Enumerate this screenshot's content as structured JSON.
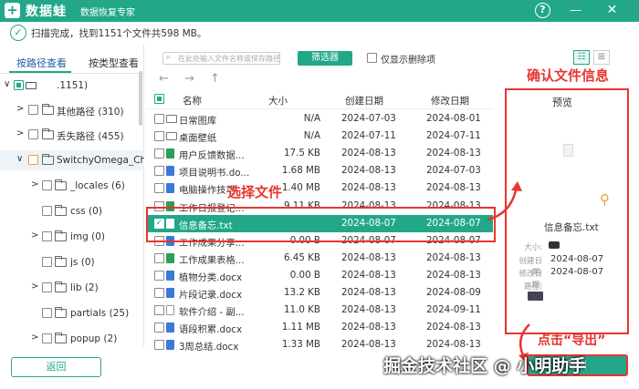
{
  "app": {
    "name": "数据蛙",
    "subtitle": "数据恢复专家"
  },
  "window": {
    "help": "?",
    "minimize": "—",
    "close": "✕"
  },
  "status": {
    "text": "扫描完成，找到1151个文件共598 MB。"
  },
  "tabs": {
    "by_path": "按路径查看",
    "by_type": "按类型查看"
  },
  "tree": {
    "root": {
      "label": ".1151)"
    },
    "items": [
      {
        "label": "其他路径 (310)"
      },
      {
        "label": "丢失路径 (455)"
      },
      {
        "label": "SwitchyOmega_Chrom"
      },
      {
        "label": "_locales (6)"
      },
      {
        "label": "css (0)"
      },
      {
        "label": "img (0)"
      },
      {
        "label": "js (0)"
      },
      {
        "label": "lib (2)"
      },
      {
        "label": "partials (25)"
      },
      {
        "label": "popup (2)"
      }
    ]
  },
  "toolbar": {
    "search_placeholder": "在此处输入文件名称或保存路径",
    "filter_label": "筛选器",
    "deleted_only_label": "仅显示删除项"
  },
  "nav": {
    "back": "←",
    "forward": "→",
    "up": "↑"
  },
  "columns": {
    "name": "名称",
    "size": "大小",
    "created": "创建日期",
    "modified": "修改日期"
  },
  "files": [
    {
      "name": "日常图库",
      "size": "N/A",
      "created": "2024-07-03",
      "modified": "2024-08-01",
      "icon": "folder-icon"
    },
    {
      "name": "桌面壁纸",
      "size": "N/A",
      "created": "2024-07-11",
      "modified": "2024-07-11",
      "icon": "folder-icon"
    },
    {
      "name": "用户反馈数据...",
      "size": "17.5 KB",
      "created": "2024-08-13",
      "modified": "2024-08-13",
      "icon": "excel-icon"
    },
    {
      "name": "项目说明书.do...",
      "size": "1.68 MB",
      "created": "2024-08-13",
      "modified": "2024-07-03",
      "icon": "word-icon"
    },
    {
      "name": "电脑操作技巧...",
      "size": "1.40 MB",
      "created": "2024-08-13",
      "modified": "2024-08-13",
      "icon": "word-icon"
    },
    {
      "name": "工作日报登记...",
      "size": "9.11 KB",
      "created": "2024-08-13",
      "modified": "2024-08-13",
      "icon": "excel-icon"
    },
    {
      "name": "信息备忘.txt",
      "size": "",
      "created": "2024-08-07",
      "modified": "2024-08-07",
      "icon": "text-file-icon"
    },
    {
      "name": "工作成果分享...",
      "size": "0.00  B",
      "created": "2024-08-07",
      "modified": "2024-08-07",
      "icon": "word-icon"
    },
    {
      "name": "工作成果表格...",
      "size": "6.45 KB",
      "created": "2024-08-13",
      "modified": "2024-08-13",
      "icon": "excel-icon"
    },
    {
      "name": "植物分类.docx",
      "size": "0.00  B",
      "created": "2024-08-13",
      "modified": "2024-08-13",
      "icon": "word-icon"
    },
    {
      "name": "片段记录.docx",
      "size": "13.2 KB",
      "created": "2024-08-13",
      "modified": "2024-08-09",
      "icon": "word-icon"
    },
    {
      "name": "软件介绍 - 副...",
      "size": "11.0 KB",
      "created": "2024-08-13",
      "modified": "2024-09-11",
      "icon": "text-file-icon"
    },
    {
      "name": "语段积累.docx",
      "size": "1.11 MB",
      "created": "2024-08-13",
      "modified": "2024-08-13",
      "icon": "word-icon"
    },
    {
      "name": "3周总结.docx",
      "size": "1.33 MB",
      "created": "2024-08-13",
      "modified": "2024-08-13",
      "icon": "word-icon"
    }
  ],
  "preview": {
    "title": "预览",
    "filename": "信息备忘.txt",
    "size_key": "大小:",
    "created_key": "创建日期:",
    "modified_key": "修改日期:",
    "path_key": "路径:",
    "created": "2024-08-07",
    "modified": "2024-08-07"
  },
  "buttons": {
    "back": "返回",
    "export": "导出"
  },
  "annotations": {
    "confirm": "确认文件信息",
    "select": "选择文件",
    "export": "点击“导出”"
  },
  "watermark": "掘金技术社区 @ 小明助手",
  "colors": {
    "accent": "#22a889",
    "annotation": "#e8352f",
    "partial_check": "#e8a23c"
  }
}
